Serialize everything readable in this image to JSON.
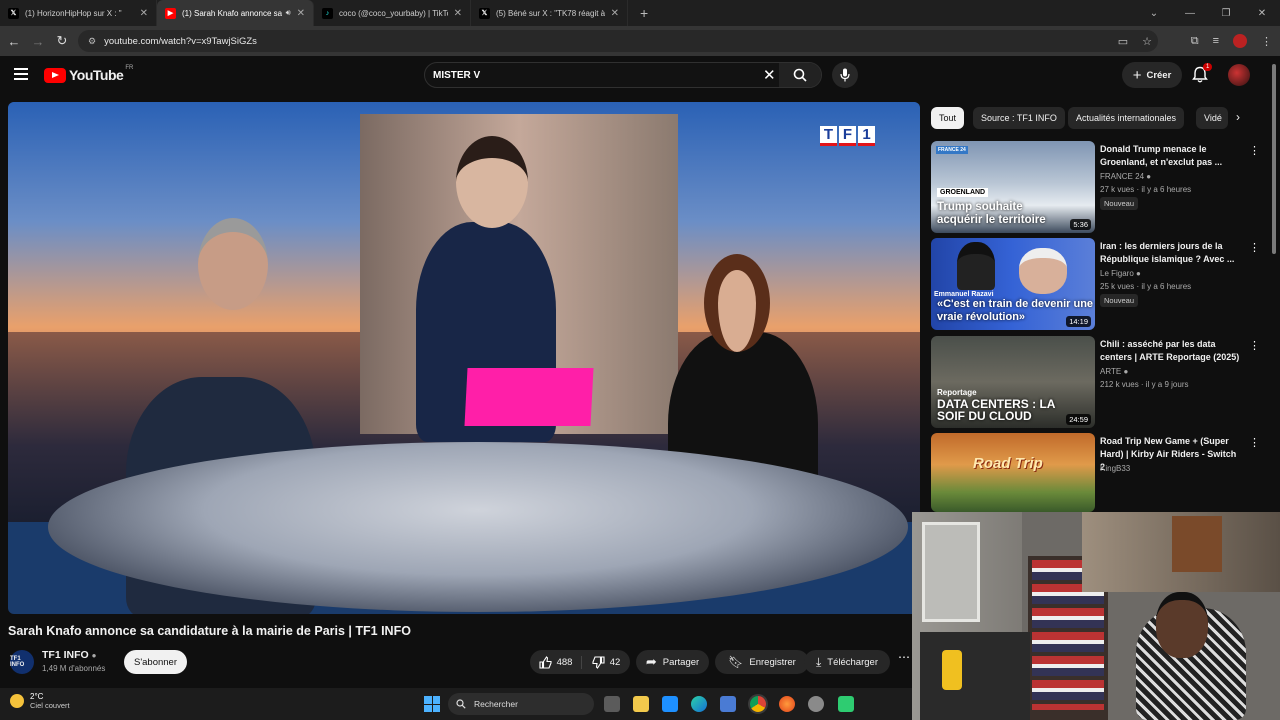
{
  "browser": {
    "tabs": [
      {
        "title": "(1) HorizonHipHop sur X : \"",
        "favicon": "x-logo",
        "active": false
      },
      {
        "title": "(1) Sarah Knafo annonce sa",
        "favicon": "youtube-logo",
        "active": true,
        "audio": true
      },
      {
        "title": "coco (@coco_yourbaby) | TikTo",
        "favicon": "tiktok-logo",
        "active": false
      },
      {
        "title": "(5) Béné sur X : \"TK78 réagit à l",
        "favicon": "x-logo",
        "active": false
      }
    ],
    "url": "youtube.com/watch?v=x9TawjSiGZs"
  },
  "youtube": {
    "logo_text": "YouTube",
    "region": "FR",
    "search_value": "MISTER V",
    "create_label": "Créer",
    "notif_count": "1"
  },
  "video": {
    "channel_logo_letters": [
      "T",
      "F",
      "1"
    ],
    "title": "Sarah Knafo annonce sa candidature à la mairie de Paris | TF1 INFO",
    "channel": "TF1 INFO",
    "subscribers": "1,49 M d'abonnés",
    "subscribe_label": "S'abonner",
    "likes": "488",
    "dislikes": "42",
    "share_label": "Partager",
    "save_label": "Enregistrer",
    "download_label": "Télécharger",
    "channel_avatar_text": "TF1 INFO"
  },
  "chips": [
    "Tout",
    "Source : TF1 INFO",
    "Actualités internationales",
    "Vidé"
  ],
  "recommendations": [
    {
      "title": "Donald Trump menace le Groenland, et n'exclut pas ...",
      "channel": "FRANCE 24",
      "meta": "27 k vues · il y a 6 heures",
      "badge": "Nouveau",
      "duration": "5:36",
      "thumb_tag": "GROENLAND",
      "thumb_caption": "Trump souhaite acquérir le territoire",
      "thumb_logo": "FRANCE 24"
    },
    {
      "title": "Iran : les derniers jours de la République islamique ? Avec ...",
      "channel": "Le Figaro",
      "meta": "25 k vues · il y a 6 heures",
      "badge": "Nouveau",
      "duration": "14:19",
      "thumb_tag": "Emmanuel Razavi",
      "thumb_caption": "«C'est en train de devenir une vraie révolution»"
    },
    {
      "title": "Chili : asséché par les data centers | ARTE Reportage (2025)",
      "channel": "ARTE",
      "meta": "212 k vues · il y a 9 jours",
      "duration": "24:59",
      "thumb_tag": "Reportage",
      "thumb_caption": "DATA CENTERS : LA SOIF DU CLOUD"
    },
    {
      "title": "Road Trip  New Game + (Super Hard) | Kirby Air Riders - Switch 2",
      "channel": "KingB33",
      "thumb_caption": "Road Trip"
    }
  ],
  "taskbar": {
    "temperature": "2°C",
    "weather": "Ciel couvert",
    "search_placeholder": "Rechercher"
  },
  "colors": {
    "yt_red": "#ff0000",
    "background": "#0f0f0f",
    "chip_bg": "#272727",
    "pink_folder": "#ff1fa8",
    "tf1_blue": "#1a3d9a"
  }
}
